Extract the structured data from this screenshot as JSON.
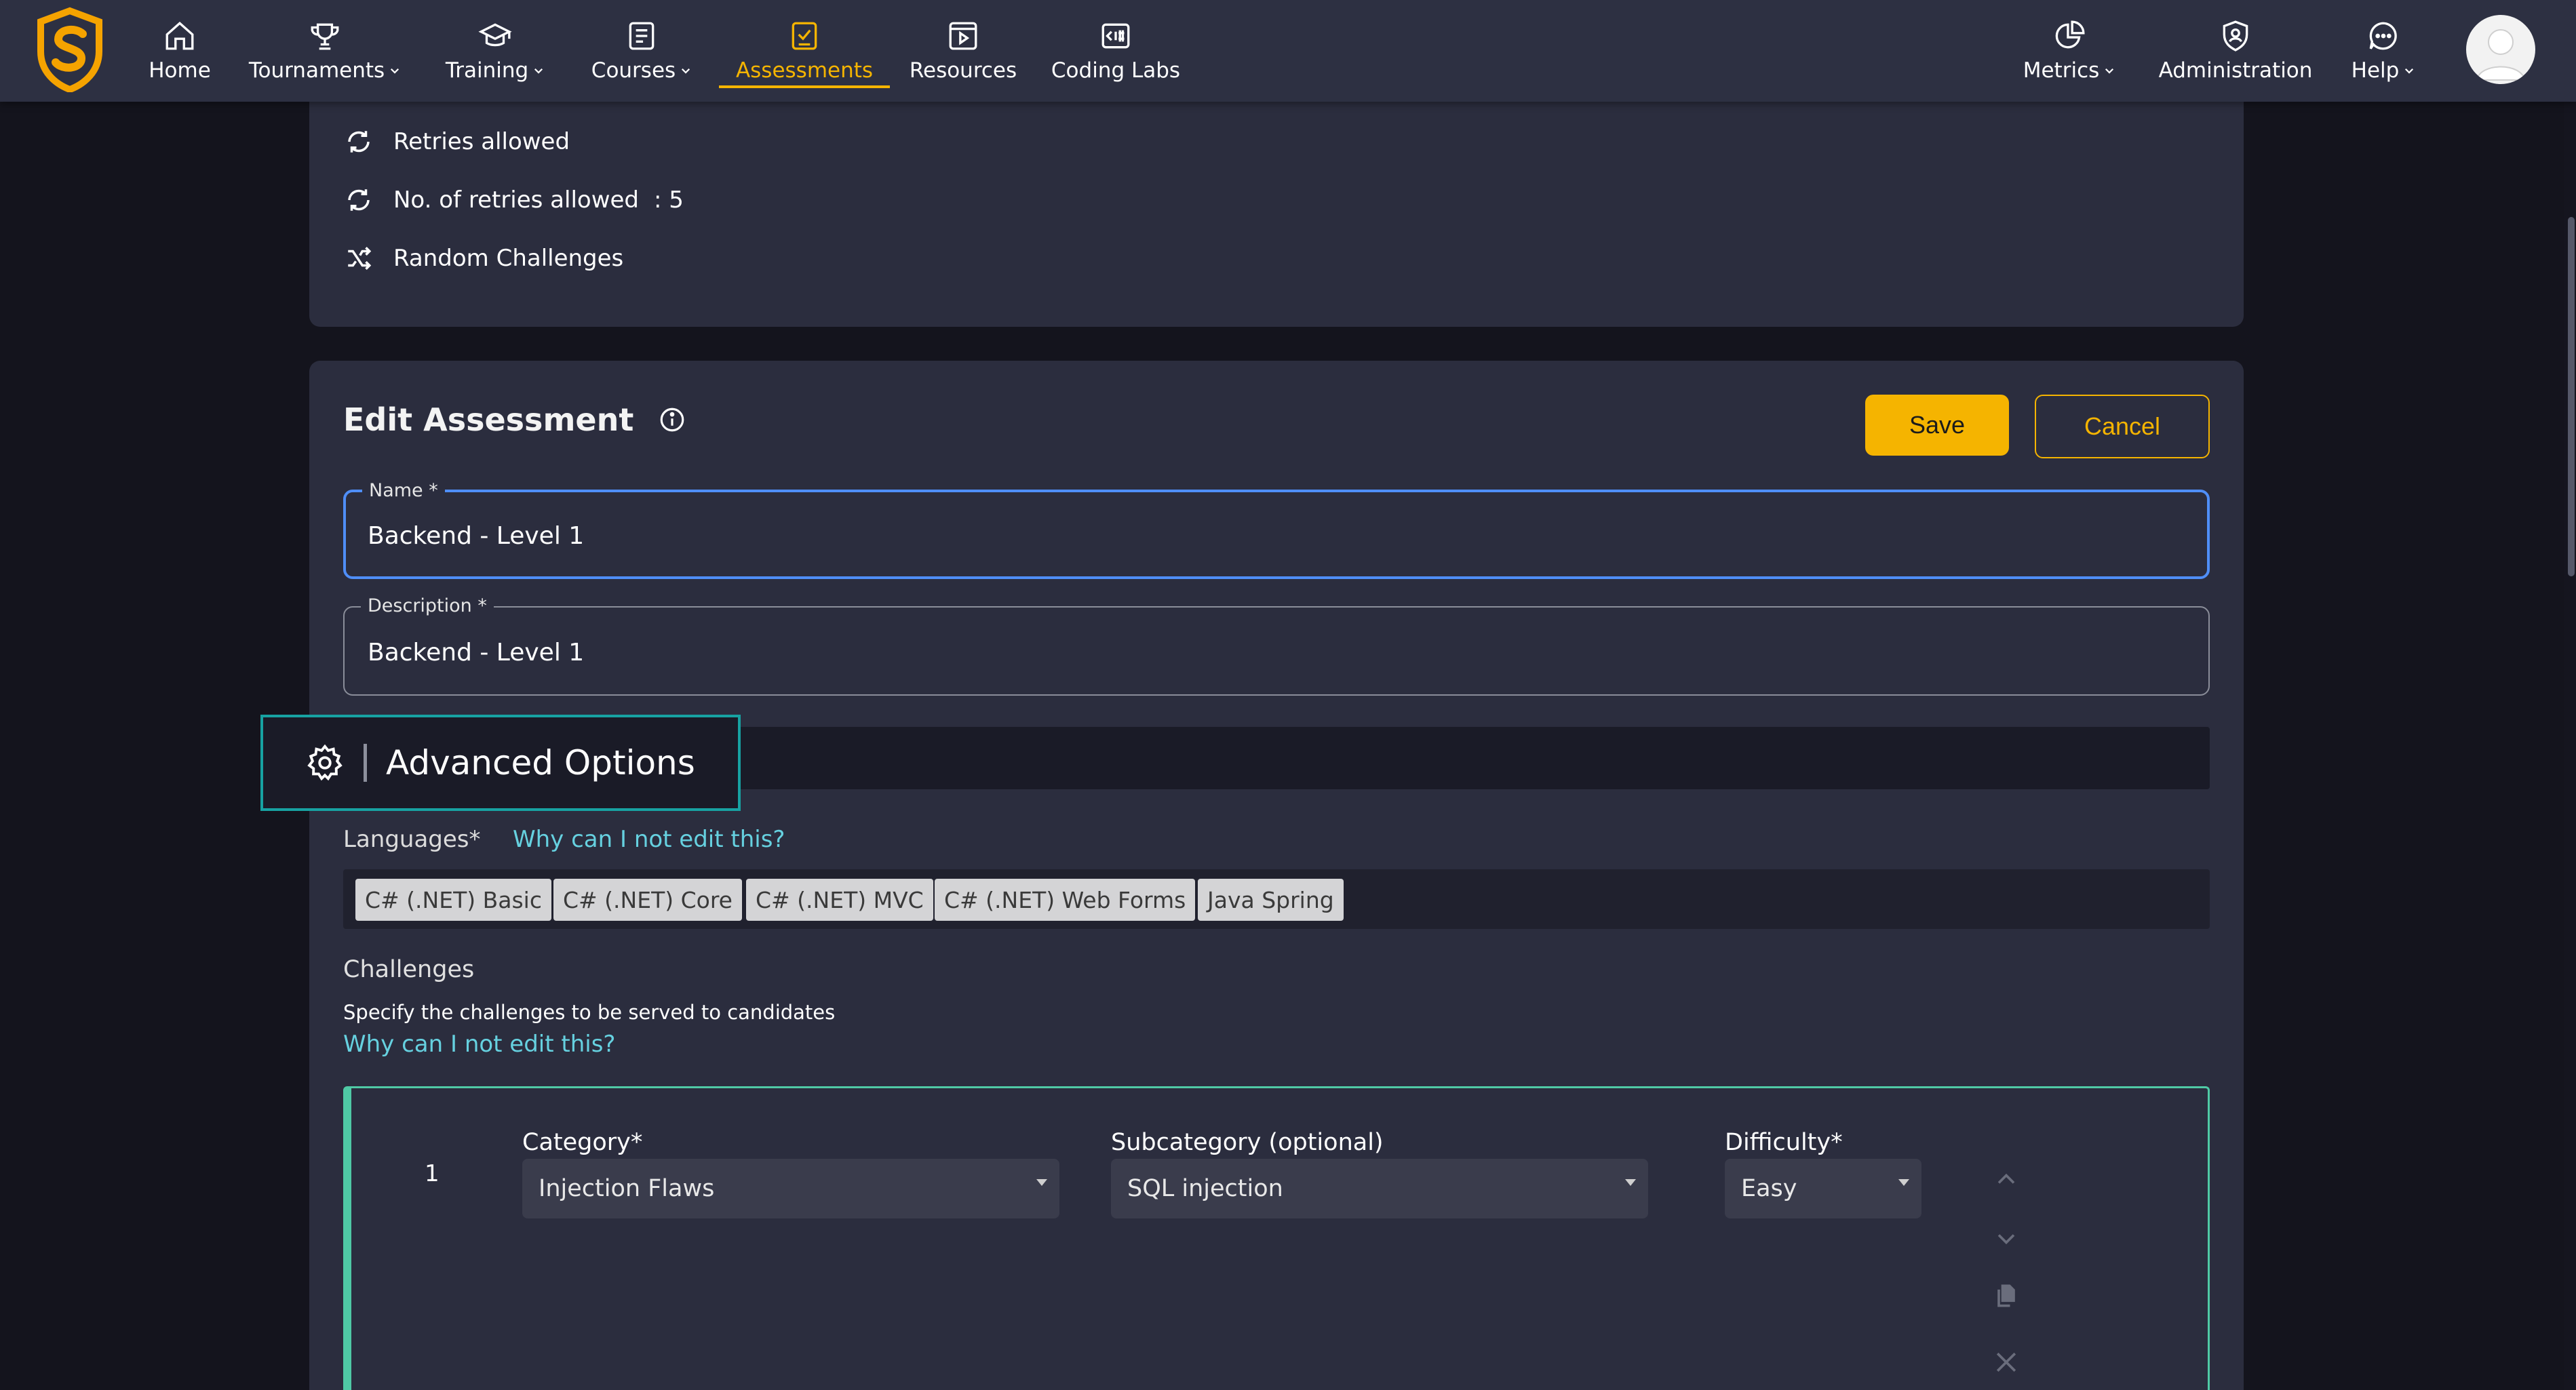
{
  "nav": {
    "items": [
      {
        "label": "Home",
        "icon": "home-icon"
      },
      {
        "label": "Tournaments",
        "icon": "trophy-icon",
        "dropdown": true
      },
      {
        "label": "Training",
        "icon": "graduation-cap-icon",
        "dropdown": true
      },
      {
        "label": "Courses",
        "icon": "book-icon",
        "dropdown": true
      },
      {
        "label": "Assessments",
        "icon": "checklist-icon",
        "active": true
      },
      {
        "label": "Resources",
        "icon": "media-icon"
      },
      {
        "label": "Coding Labs",
        "icon": "code-icon"
      },
      {
        "label": "Metrics",
        "icon": "pie-chart-icon",
        "dropdown": true
      },
      {
        "label": "Administration",
        "icon": "admin-shield-icon"
      },
      {
        "label": "Help",
        "icon": "chat-help-icon",
        "dropdown": true
      }
    ],
    "accent": "#f5b400"
  },
  "summary": {
    "retries_allowed": "Retries allowed",
    "retries_count_label": "No. of retries allowed",
    "retries_count_value": ": 5",
    "random_challenges": "Random Challenges"
  },
  "edit": {
    "title": "Edit Assessment",
    "save_label": "Save",
    "cancel_label": "Cancel",
    "name_legend": "Name *",
    "name_value": "Backend - Level 1",
    "description_legend": "Description *",
    "description_value": "Backend - Level 1",
    "advanced_options": "Advanced Options",
    "languages_label": "Languages*",
    "why_edit_link": "Why can I not edit this?",
    "languages": [
      "C# (.NET) Basic",
      "C# (.NET) Core",
      "C# (.NET) MVC",
      "C# (.NET) Web Forms",
      "Java Spring"
    ],
    "challenges_title": "Challenges",
    "challenges_sub": "Specify the challenges to be served to candidates",
    "challenges_why_link": "Why can I not edit this?"
  },
  "challenge_rows": [
    {
      "number": "1",
      "category_label": "Category*",
      "category_value": "Injection Flaws",
      "subcategory_label": "Subcategory (optional)",
      "subcategory_value": "SQL injection",
      "difficulty_label": "Difficulty*",
      "difficulty_value": "Easy"
    }
  ]
}
